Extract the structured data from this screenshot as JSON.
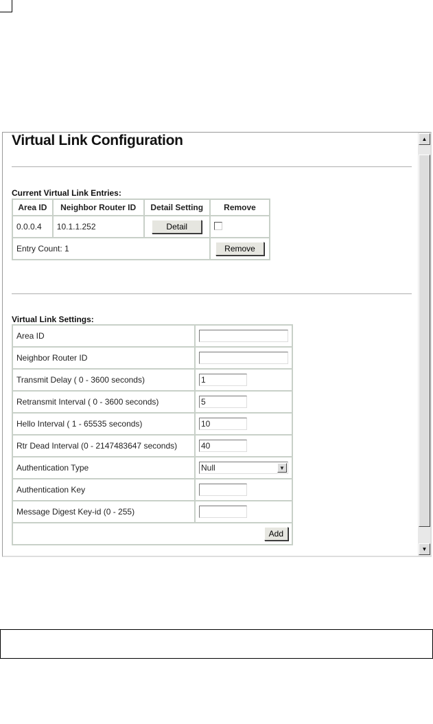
{
  "title": "Virtual Link Configuration",
  "entries": {
    "heading": "Current Virtual Link Entries:",
    "columns": [
      "Area ID",
      "Neighbor Router ID",
      "Detail Setting",
      "Remove"
    ],
    "rows": [
      {
        "area_id": "0.0.0.4",
        "neighbor": "10.1.1.252",
        "detail_label": "Detail",
        "remove_checked": false
      }
    ],
    "entry_count": "Entry Count: 1",
    "remove_label": "Remove"
  },
  "settings": {
    "heading": "Virtual Link Settings:",
    "fields": [
      {
        "label": "Area ID",
        "value": ""
      },
      {
        "label": "Neighbor Router ID",
        "value": ""
      },
      {
        "label": "Transmit Delay ( 0 - 3600 seconds)",
        "value": "1"
      },
      {
        "label": "Retransmit Interval ( 0 - 3600 seconds)",
        "value": "5"
      },
      {
        "label": "Hello Interval ( 1 - 65535 seconds)",
        "value": "10"
      },
      {
        "label": "Rtr Dead Interval (0 - 2147483647 seconds)",
        "value": "40"
      },
      {
        "label": "Authentication Type",
        "value": "Null"
      },
      {
        "label": "Authentication Key",
        "value": ""
      },
      {
        "label": "Message Digest Key-id (0 - 255)",
        "value": ""
      }
    ],
    "add_label": "Add"
  }
}
